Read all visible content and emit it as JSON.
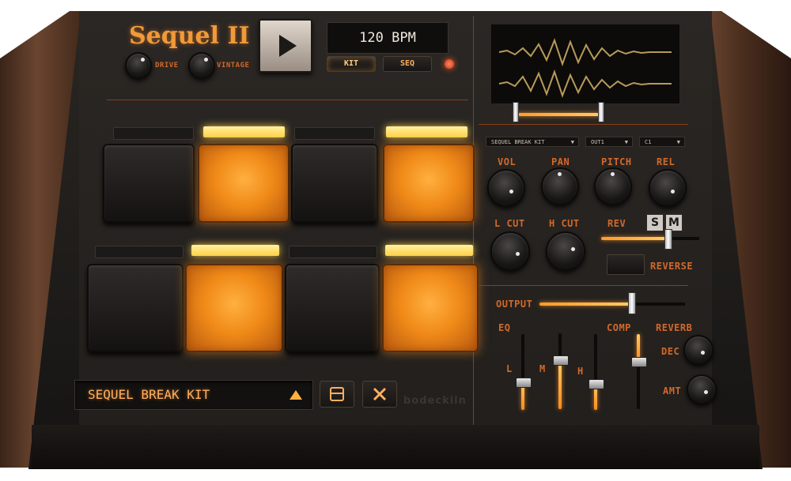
{
  "brand": {
    "logo_text": "Sequel II",
    "maker": "bodeckiln"
  },
  "header": {
    "knobs": [
      {
        "label": "DRIVE"
      },
      {
        "label": "VINTAGE"
      }
    ],
    "bpm_display": "120 BPM",
    "mode_buttons": [
      {
        "label": "KIT",
        "active": true
      },
      {
        "label": "SEQ",
        "active": false
      }
    ],
    "play_icon": "play-icon"
  },
  "pads": {
    "rows": [
      [
        {
          "state": "off"
        },
        {
          "state": "on"
        },
        {
          "state": "off"
        },
        {
          "state": "on"
        }
      ],
      [
        {
          "state": "off"
        },
        {
          "state": "on"
        },
        {
          "state": "off"
        },
        {
          "state": "on"
        }
      ]
    ]
  },
  "preset_bar": {
    "name": "SEQUEL BREAK KIT",
    "up_icon": "triangle-up-icon",
    "save_icon": "save-icon",
    "close_icon": "close-icon"
  },
  "sample_panel": {
    "dropdowns": [
      {
        "value": "SEQUEL BREAK KIT"
      },
      {
        "value": "OUT1"
      },
      {
        "value": "C1"
      }
    ],
    "knob_row1": [
      {
        "label": "VOL"
      },
      {
        "label": "PAN"
      },
      {
        "label": "PITCH"
      },
      {
        "label": "REL"
      }
    ],
    "knob_row2": [
      {
        "label": "L CUT"
      },
      {
        "label": "H CUT"
      }
    ],
    "rev_label": "REV",
    "solo_label": "S",
    "mute_label": "M",
    "reverse_label": "REVERSE"
  },
  "mixer": {
    "output_label": "OUTPUT",
    "eq_label": "EQ",
    "comp_label": "COMP",
    "reverb_label": "REVERB",
    "eq_band_labels": [
      "L",
      "M",
      "H"
    ],
    "dec_label": "DEC",
    "amt_label": "AMT"
  },
  "colors": {
    "accent": "#e07a2a",
    "pad_lit": "#f08a18",
    "indicator_on": "#ffd24a"
  }
}
